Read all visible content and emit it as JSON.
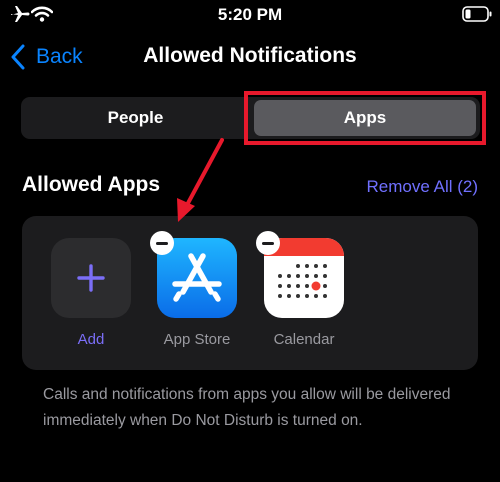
{
  "status_bar": {
    "time": "5:20 PM"
  },
  "nav": {
    "back_label": "Back",
    "title": "Allowed Notifications"
  },
  "segmented": {
    "people_label": "People",
    "apps_label": "Apps"
  },
  "section": {
    "title": "Allowed Apps",
    "remove_all_label": "Remove All (2)"
  },
  "apps": {
    "add_label": "Add",
    "app_store_label": "App Store",
    "calendar_label": "Calendar"
  },
  "footer": {
    "description": "Calls and notifications from apps you allow will be delivered immediately when Do Not Disturb is turned on."
  },
  "colors": {
    "accent_blue": "#0a84ff",
    "remove_all_purple": "#7070ff",
    "annotation_red": "#e8192c"
  }
}
